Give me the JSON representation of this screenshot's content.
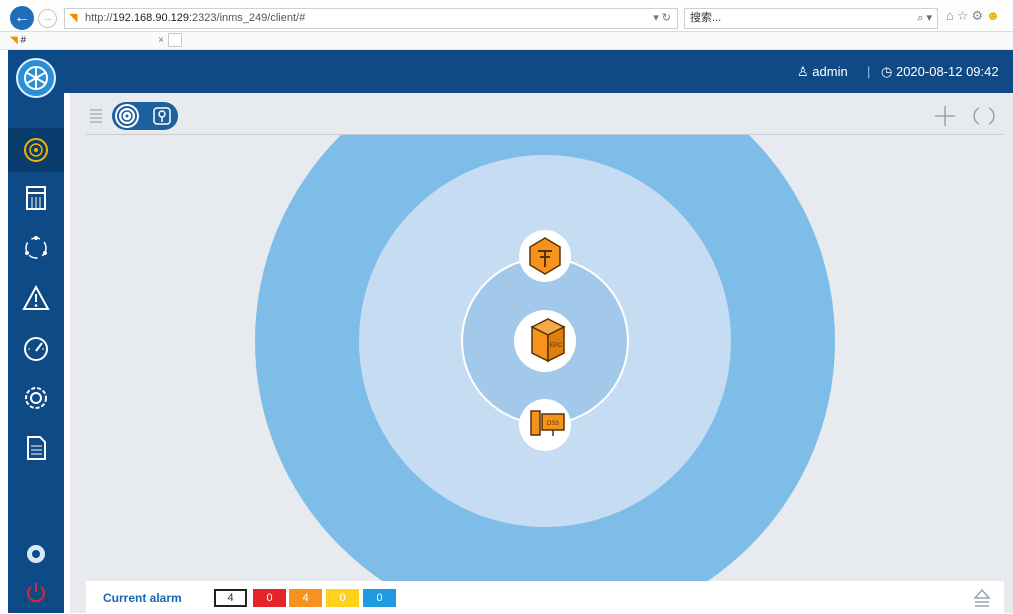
{
  "browser": {
    "url_scheme": "http://",
    "url_host": "192.168.90.129",
    "url_rest": ":2323/inms_249/client/#",
    "url_tools": "▾ ↻",
    "search_placeholder": "搜索...",
    "search_tools": "⌕ ▾",
    "tab_title": "#",
    "tab_close": "×"
  },
  "header": {
    "user": "admin",
    "separator": "|",
    "datetime": "2020-08-12 09:42"
  },
  "sidebar": {
    "items": [
      {
        "name": "topology-icon",
        "active": true
      },
      {
        "name": "inventory-icon"
      },
      {
        "name": "cycle-icon"
      },
      {
        "name": "alarm-warning-icon"
      },
      {
        "name": "performance-gauge-icon"
      },
      {
        "name": "settings-gear-icon"
      },
      {
        "name": "report-document-icon"
      },
      {
        "name": "eye-icon"
      },
      {
        "name": "power-icon"
      }
    ]
  },
  "toolbar": {
    "plus_icon": "add-icon",
    "refresh_icon": "refresh-icon"
  },
  "topology": {
    "nodes": [
      {
        "name": "router-node",
        "label": ""
      },
      {
        "name": "epc-node",
        "label": "EPC"
      },
      {
        "name": "dss-node",
        "label": "DSS"
      }
    ],
    "colors": {
      "outer_ring": "#7fbde9",
      "middle_ring": "#c5dcf2",
      "inner_ring": "#a2c8ea",
      "node": "#f5931e"
    }
  },
  "alarm_bar": {
    "label": "Current alarm",
    "total": "4",
    "critical": "0",
    "major": "4",
    "minor": "0",
    "warning": "0"
  }
}
